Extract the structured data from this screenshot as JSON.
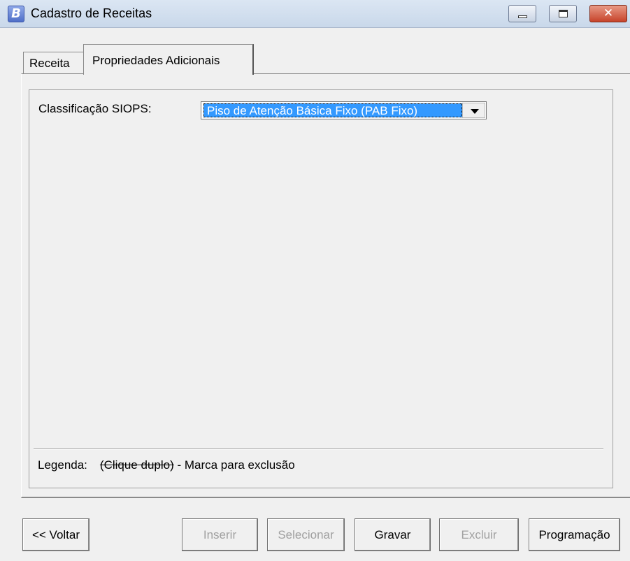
{
  "window": {
    "title": "Cadastro de Receitas",
    "app_icon_letter": "B",
    "close_glyph": "✕"
  },
  "tabs": [
    {
      "label": "Receita",
      "active": false
    },
    {
      "label": "Propriedades Adicionais",
      "active": true
    }
  ],
  "form": {
    "classificacao_label": "Classificação SIOPS:",
    "classificacao_value": "Piso de Atenção Básica Fixo (PAB Fixo)"
  },
  "legend": {
    "label": "Legenda:",
    "key": "(Clique duplo)",
    "description": " - Marca para exclusão"
  },
  "buttons": {
    "voltar": "<< Voltar",
    "inserir": "Inserir",
    "selecionar": "Selecionar",
    "gravar": "Gravar",
    "excluir": "Excluir",
    "programacao": "Programação"
  }
}
